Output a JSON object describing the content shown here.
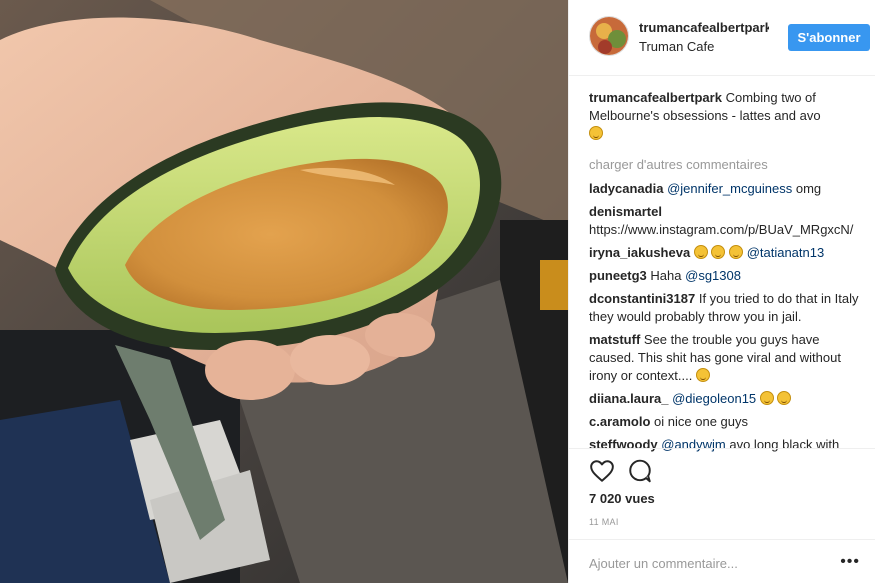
{
  "header": {
    "username": "trumancafealbertpark",
    "location": "Truman Cafe",
    "follow_label": "S'abonner"
  },
  "caption": {
    "username": "trumancafealbertpark",
    "text": "Combing two of Melbourne's obsessions - lattes and avo"
  },
  "load_more": "charger d'autres commentaires",
  "comments": [
    {
      "user": "ladycanadia",
      "mention": "@jennifer_mcguiness",
      "text": " omg"
    },
    {
      "user": "denismartel",
      "text": "https://www.instagram.com/p/BUaV_MRgxcN/"
    },
    {
      "user": "iryna_iakusheva",
      "mention": "@tatianatn13",
      "text": ""
    },
    {
      "user": "puneetg3",
      "text": "Haha ",
      "mention": "@sg1308"
    },
    {
      "user": "dconstantini3187",
      "text": "If you tried to do that in Italy they would probably throw you in jail."
    },
    {
      "user": "matstuff",
      "text": "See the trouble you guys have caused. This shit has gone viral and without irony or context...."
    },
    {
      "user": "diiana.laura_",
      "mention": "@diegoleon15",
      "text": ""
    },
    {
      "user": "c.aramolo",
      "text": "oi nice one guys"
    },
    {
      "user": "steffwoody",
      "mention": "@andywjm",
      "text": " avo long black with"
    }
  ],
  "actions": {
    "like_icon": "heart-icon",
    "comment_icon": "comment-icon",
    "views": "7 020 vues",
    "date": "11 MAI"
  },
  "add_comment": {
    "placeholder": "Ajouter un commentaire...",
    "more_icon": "ellipsis-icon"
  },
  "colors": {
    "accent": "#3897f0",
    "mention": "#003569",
    "muted": "#999999"
  }
}
